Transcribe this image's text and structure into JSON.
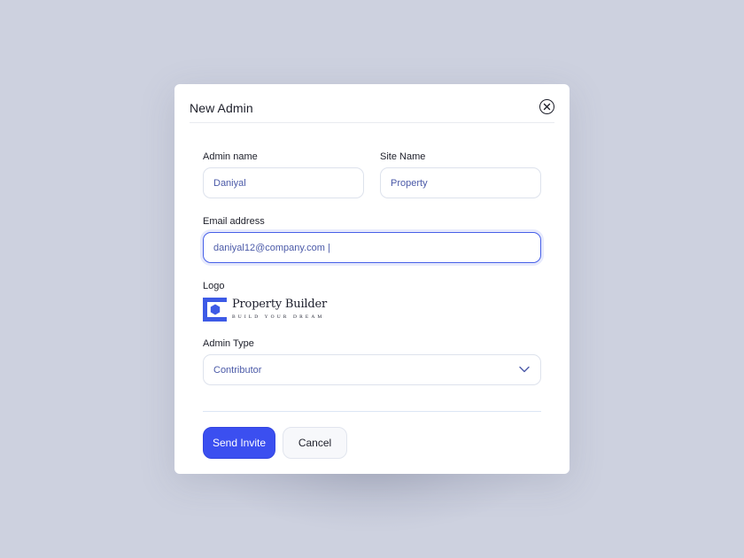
{
  "modal": {
    "title": "New Admin"
  },
  "form": {
    "admin_name": {
      "label": "Admin name",
      "value": "Daniyal"
    },
    "site_name": {
      "label": "Site Name",
      "value": "Property"
    },
    "email": {
      "label": "Email address",
      "value": "daniyal12@company.com |"
    },
    "logo": {
      "label": "Logo",
      "brand_name": "Property Builder",
      "tagline": "BUILD YOUR DREAM"
    },
    "admin_type": {
      "label": "Admin Type",
      "value": "Contributor"
    }
  },
  "actions": {
    "send_label": "Send Invite",
    "cancel_label": "Cancel"
  },
  "icons": {
    "close": "close-icon",
    "chevron": "chevron-down-icon",
    "logo_mark": "hexagon-logo-icon"
  },
  "colors": {
    "accent": "#3b4ff0",
    "focus_border": "#4760e8",
    "input_text": "#4b5aa8",
    "background": "#cdd1df"
  }
}
